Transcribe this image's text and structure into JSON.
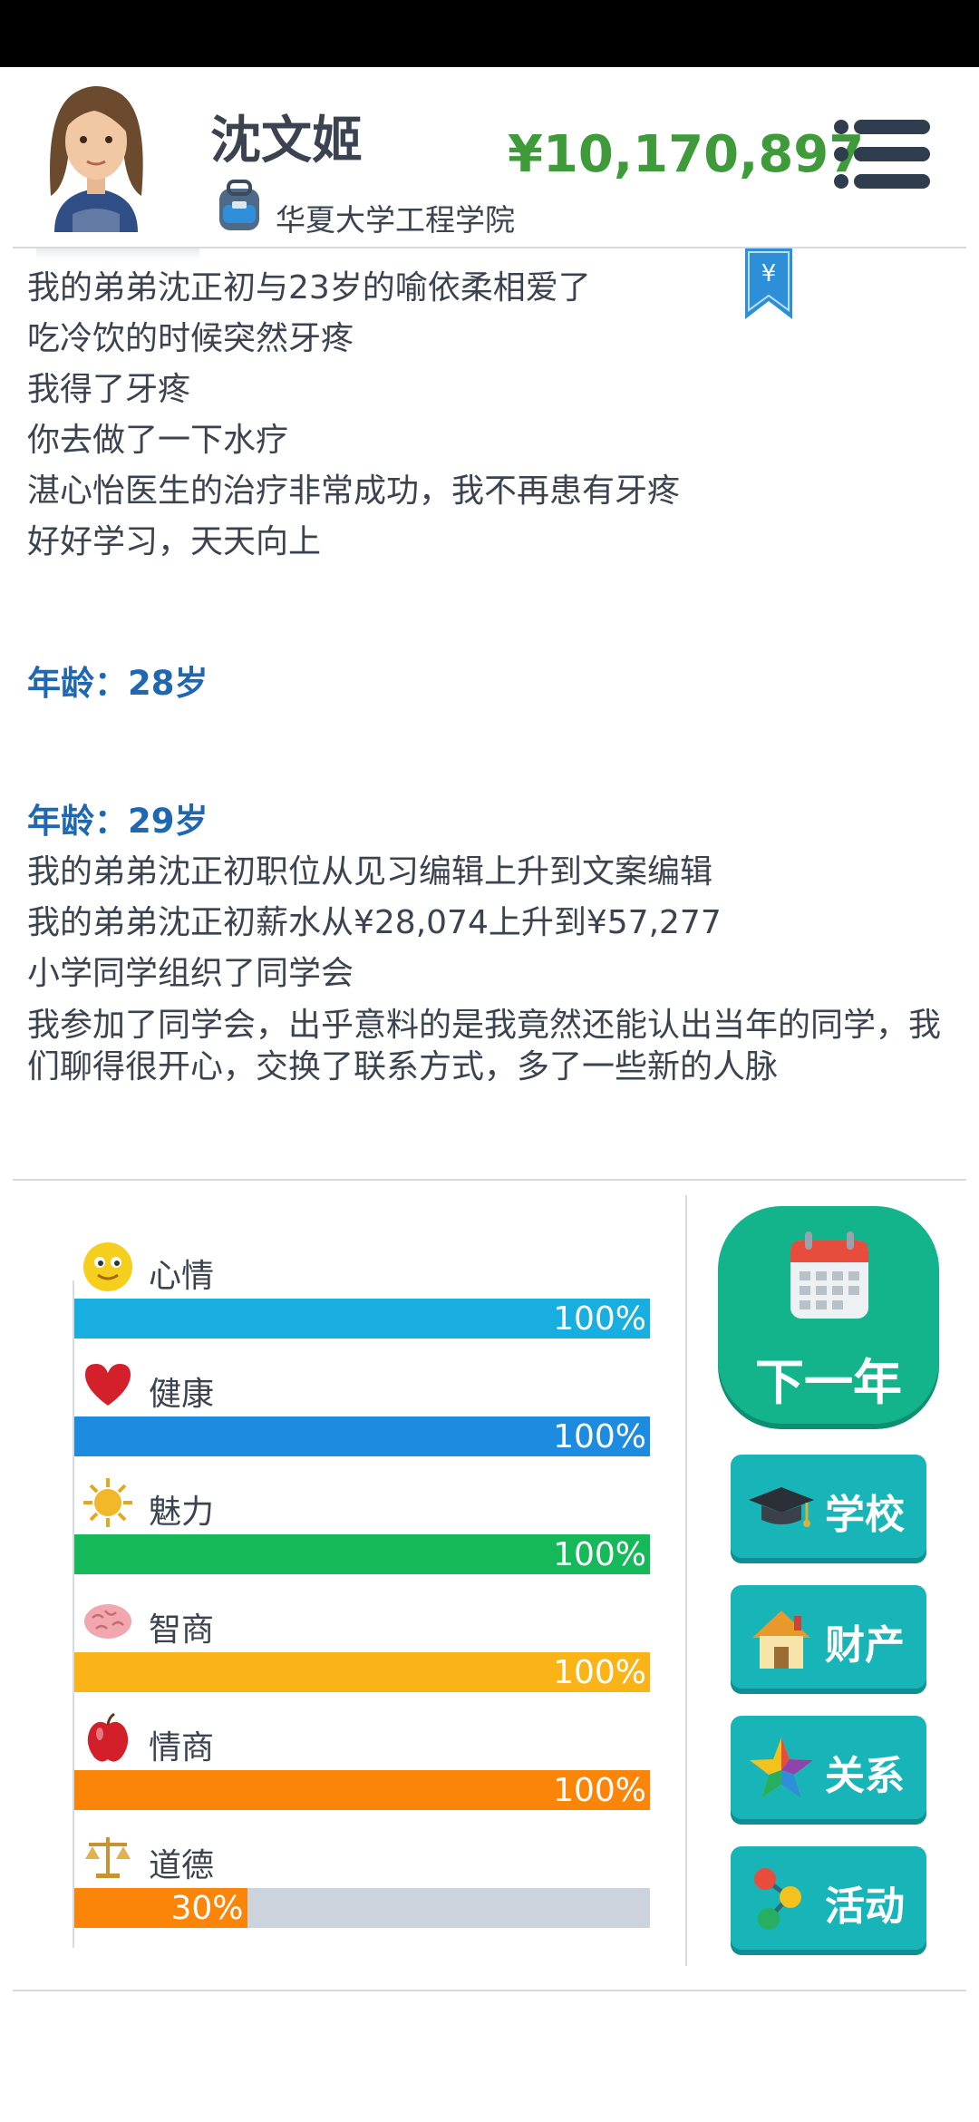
{
  "header": {
    "name": "沈文姬",
    "school": "华夏大学工程学院",
    "money": "¥10,170,897"
  },
  "log": {
    "block1": [
      "我的弟弟沈正初与23岁的喻依柔相爱了",
      "吃冷饮的时候突然牙疼",
      "我得了牙疼",
      "你去做了一下水疗",
      "湛心怡医生的治疗非常成功，我不再患有牙疼",
      "好好学习，天天向上"
    ],
    "age28": "年龄：28岁",
    "age29": "年龄：29岁",
    "block2": [
      "我的弟弟沈正初职位从见习编辑上升到文案编辑",
      "我的弟弟沈正初薪水从¥28,074上升到¥57,277",
      "小学同学组织了同学会",
      "我参加了同学会，出乎意料的是我竟然还能认出当年的同学，我们聊得很开心，交换了联系方式，多了一些新的人脉"
    ]
  },
  "stats": [
    {
      "label": "心情",
      "value": 100,
      "text": "100%",
      "color": "#18aee0",
      "icon": "smiley-icon"
    },
    {
      "label": "健康",
      "value": 100,
      "text": "100%",
      "color": "#1d8be0",
      "icon": "heart-icon"
    },
    {
      "label": "魅力",
      "value": 100,
      "text": "100%",
      "color": "#16b95a",
      "icon": "sun-icon"
    },
    {
      "label": "智商",
      "value": 100,
      "text": "100%",
      "color": "#fbb417",
      "icon": "brain-icon"
    },
    {
      "label": "情商",
      "value": 100,
      "text": "100%",
      "color": "#fb8509",
      "icon": "apple-icon"
    },
    {
      "label": "道德",
      "value": 30,
      "text": "30%",
      "color": "#fb8509",
      "icon": "scales-icon"
    }
  ],
  "actions": {
    "next_year": "下一年",
    "school": "学校",
    "assets": "财产",
    "relations": "关系",
    "activities": "活动"
  }
}
